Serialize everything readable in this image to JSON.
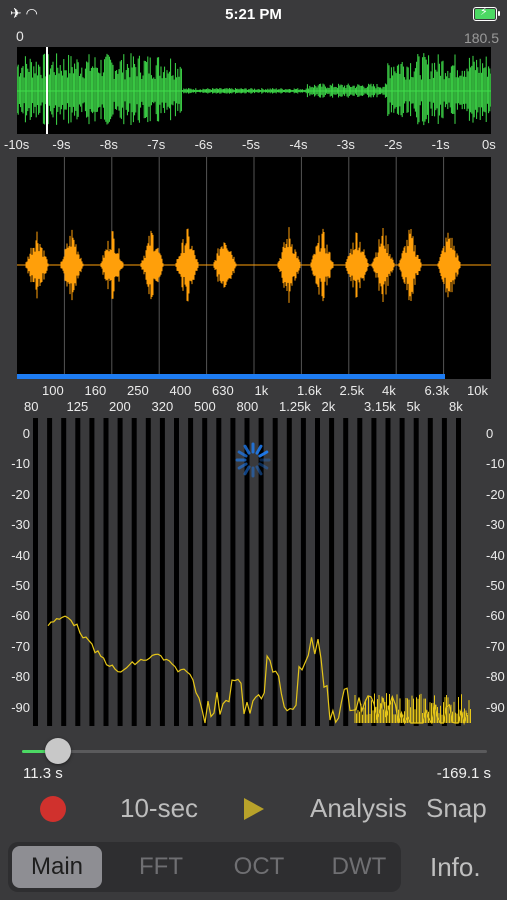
{
  "status": {
    "time": "5:21 PM",
    "icons": [
      "airplane-icon",
      "wifi-icon",
      "battery-charging-icon"
    ]
  },
  "waveform": {
    "left_value": "0",
    "right_value": "180.5",
    "time_ticks": [
      "-10s",
      "-9s",
      "-8s",
      "-7s",
      "-6s",
      "-5s",
      "-4s",
      "-3s",
      "-2s",
      "-1s",
      "0s"
    ],
    "color": "#3fdc4a"
  },
  "detail": {
    "color": "#ff9f0a",
    "progress_color": "#1e7cf2"
  },
  "freq_axis": {
    "top": [
      "100",
      "160",
      "250",
      "400",
      "630",
      "1k",
      "1.6k",
      "2.5k",
      "4k",
      "6.3k",
      "10k"
    ],
    "bottom": [
      "80",
      "125",
      "200",
      "320",
      "500",
      "800",
      "1.25k",
      "2k",
      "3.15k",
      "5k",
      "8k"
    ]
  },
  "spectrum": {
    "db_labels": [
      "0",
      "-10",
      "-20",
      "-30",
      "-40",
      "-50",
      "-60",
      "-70",
      "-80",
      "-90"
    ],
    "line_color": "#e6c619"
  },
  "slider": {
    "left_label": "11.3 s",
    "right_label": "-169.1 s",
    "position": 0.05
  },
  "controls": {
    "mode_label": "10-sec",
    "analysis_label": "Analysis",
    "snap_label": "Snap"
  },
  "tabs": [
    "Main",
    "FFT",
    "OCT",
    "DWT"
  ],
  "info_label": "Info."
}
